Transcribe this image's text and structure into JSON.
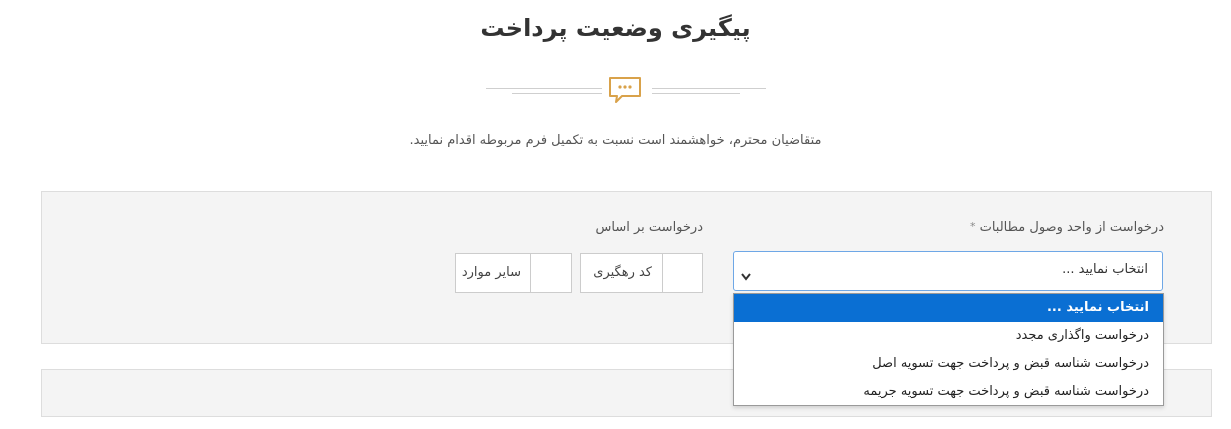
{
  "page": {
    "title": "پیگیری وضعیت پرداخت",
    "subtitle": "متقاضیان محترم، خواهشمند است نسبت به تکمیل فرم مربوطه اقدام نمایید.",
    "divider_icon": "chat-bubble-icon"
  },
  "form": {
    "request_label": "درخواست از واحد وصول مطالبات",
    "required_mark": "*",
    "basis_label": "درخواست بر اساس",
    "select_value": "انتخاب نمایید ...",
    "basis_options": [
      "کد رهگیری",
      "سایر موارد"
    ],
    "dropdown_options": [
      "انتخاب نمایید ...",
      "درخواست واگذاری مجدد",
      "درخواست شناسه قبض و پرداخت جهت تسویه اصل",
      "درخواست شناسه قبض و پرداخت جهت تسویه جریمه"
    ],
    "selected_index": 0
  },
  "colors": {
    "accent": "#0a6fd3",
    "icon": "#d9a24a",
    "panel_bg": "#f4f4f4"
  }
}
